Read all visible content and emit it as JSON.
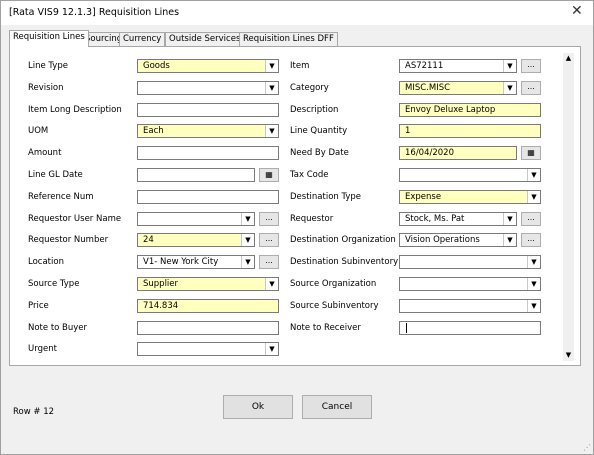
{
  "window": {
    "title": "[Rata VIS9 12.1.3] Requisition Lines",
    "close_glyph": "✕"
  },
  "tabs": [
    "Requisition Lines",
    "Sourcing",
    "Currency",
    "Outside Services",
    "Requisition Lines DFF"
  ],
  "active_tab": "Requisition Lines",
  "left_fields": [
    {
      "label": "Line Type",
      "value": "Goods",
      "type": "dropdown",
      "required": true
    },
    {
      "label": "Revision",
      "value": "",
      "type": "dropdown",
      "required": false
    },
    {
      "label": "Item Long Description",
      "value": "",
      "type": "text",
      "required": false
    },
    {
      "label": "UOM",
      "value": "Each",
      "type": "dropdown",
      "required": true
    },
    {
      "label": "Amount",
      "value": "",
      "type": "text",
      "required": false
    },
    {
      "label": "Line GL Date",
      "value": "",
      "type": "date",
      "required": false
    },
    {
      "label": "Reference Num",
      "value": "",
      "type": "text",
      "required": false
    },
    {
      "label": "Requestor User Name",
      "value": "",
      "type": "dropdown-lov",
      "required": false
    },
    {
      "label": "Requestor Number",
      "value": "24",
      "type": "dropdown-lov",
      "required": true
    },
    {
      "label": "Location",
      "value": "V1- New York City",
      "type": "dropdown-lov",
      "required": false
    },
    {
      "label": "Source Type",
      "value": "Supplier",
      "type": "dropdown",
      "required": true
    },
    {
      "label": "Price",
      "value": "714.834",
      "type": "text",
      "required": true
    },
    {
      "label": "Note to Buyer",
      "value": "",
      "type": "text",
      "required": false
    },
    {
      "label": "Urgent",
      "value": "",
      "type": "dropdown",
      "required": false
    }
  ],
  "right_fields": [
    {
      "label": "Item",
      "value": "AS72111",
      "type": "dropdown-lov",
      "required": false
    },
    {
      "label": "Category",
      "value": "MISC.MISC",
      "type": "dropdown-lov",
      "required": true
    },
    {
      "label": "Description",
      "value": "Envoy Deluxe Laptop",
      "type": "text",
      "required": true
    },
    {
      "label": "Line Quantity",
      "value": "1",
      "type": "text",
      "required": true
    },
    {
      "label": "Need By Date",
      "value": "16/04/2020",
      "type": "date",
      "required": true
    },
    {
      "label": "Tax Code",
      "value": "",
      "type": "dropdown",
      "required": false
    },
    {
      "label": "Destination Type",
      "value": "Expense",
      "type": "dropdown",
      "required": true
    },
    {
      "label": "Requestor",
      "value": "Stock, Ms. Pat",
      "type": "dropdown-lov",
      "required": false
    },
    {
      "label": "Destination Organization",
      "value": "Vision Operations",
      "type": "dropdown-lov",
      "required": false
    },
    {
      "label": "Destination Subinventory",
      "value": "",
      "type": "dropdown",
      "required": false
    },
    {
      "label": "Source Organization",
      "value": "",
      "type": "dropdown",
      "required": false
    },
    {
      "label": "Source Subinventory",
      "value": "",
      "type": "dropdown",
      "required": false
    },
    {
      "label": "Note to Receiver",
      "value": "",
      "type": "text-focused",
      "required": false
    }
  ],
  "buttons": {
    "ok": "Ok",
    "cancel": "Cancel"
  },
  "status": {
    "row_text": "Row # 12"
  },
  "glyphs": {
    "dropdown": "▼",
    "lov": "...",
    "calendar": "▦",
    "scroll_up": "▲",
    "scroll_down": "▼"
  },
  "colors": {
    "required_bg": "#ffffc0",
    "field_border": "#7a7a7a",
    "window_bg": "#f0f0f0"
  }
}
